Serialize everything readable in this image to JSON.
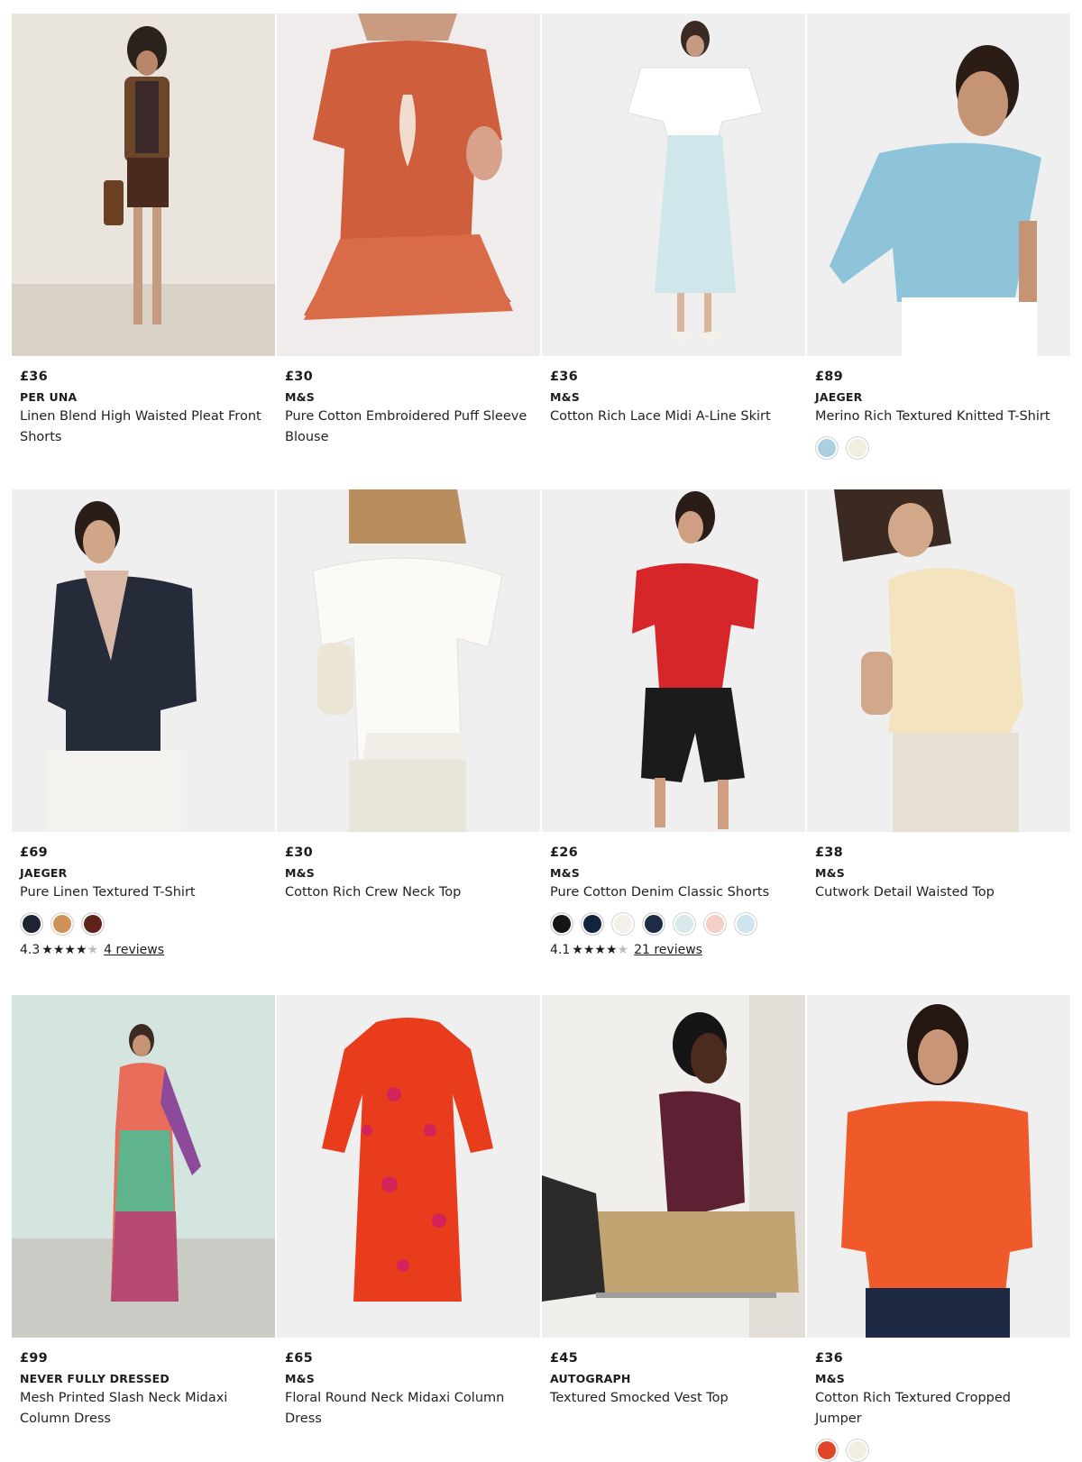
{
  "products": [
    {
      "price": "£36",
      "brand": "PER UNA",
      "name": "Linen Blend High Waisted Pleat Front Shorts",
      "image": "photo-model-brown-shorts",
      "swatches": [],
      "rating": null
    },
    {
      "price": "£30",
      "brand": "M&S",
      "name": "Pure Cotton Embroidered Puff Sleeve Blouse",
      "image": "photo-rust-blouse",
      "swatches": [],
      "rating": null
    },
    {
      "price": "£36",
      "brand": "M&S",
      "name": "Cotton Rich Lace Midi A-Line Skirt",
      "image": "photo-mint-lace-skirt",
      "swatches": [],
      "rating": null
    },
    {
      "price": "£89",
      "brand": "JAEGER",
      "name": "Merino Rich Textured Knitted T-Shirt",
      "image": "photo-blue-knit-tshirt",
      "swatches": [
        "#a9cfe0",
        "#f1eee0"
      ],
      "rating": null
    },
    {
      "price": "£69",
      "brand": "JAEGER",
      "name": "Pure Linen Textured T-Shirt",
      "image": "photo-navy-linen-tshirt",
      "swatches": [
        "#1e2333",
        "#cf9258",
        "#5e2218"
      ],
      "rating": {
        "score": "4.3",
        "stars": 4.3,
        "reviews": "4 reviews"
      }
    },
    {
      "price": "£30",
      "brand": "M&S",
      "name": "Cotton Rich Crew Neck Top",
      "image": "photo-white-peplum-top",
      "swatches": [],
      "rating": null
    },
    {
      "price": "£26",
      "brand": "M&S",
      "name": "Pure Cotton Denim Classic Shorts",
      "image": "photo-black-denim-shorts",
      "swatches": [
        "#151515",
        "#13233e",
        "#f3f1ea",
        "#1f2a44",
        "#d8e9ec",
        "#f3cfc6",
        "#cfe4ec"
      ],
      "rating": {
        "score": "4.1",
        "stars": 4.1,
        "reviews": "21 reviews"
      }
    },
    {
      "price": "£38",
      "brand": "M&S",
      "name": "Cutwork Detail Waisted Top",
      "image": "photo-cream-cutwork-top",
      "swatches": [],
      "rating": null
    },
    {
      "price": "£99",
      "brand": "NEVER FULLY DRESSED",
      "name": "Mesh Printed Slash Neck Midaxi Column Dress",
      "image": "photo-printed-maxi-dress",
      "swatches": [],
      "rating": null
    },
    {
      "price": "£65",
      "brand": "M&S",
      "name": "Floral Round Neck Midaxi Column Dress",
      "image": "photo-red-floral-dress",
      "swatches": [],
      "rating": null
    },
    {
      "price": "£45",
      "brand": "AUTOGRAPH",
      "name": "Textured Smocked Vest Top",
      "image": "photo-plum-vest-top",
      "swatches": [],
      "rating": null
    },
    {
      "price": "£36",
      "brand": "M&S",
      "name": "Cotton Rich Textured Cropped Jumper",
      "image": "photo-orange-crochet-jumper",
      "swatches": [
        "#e2462a",
        "#f1eee0"
      ],
      "rating": null
    }
  ]
}
